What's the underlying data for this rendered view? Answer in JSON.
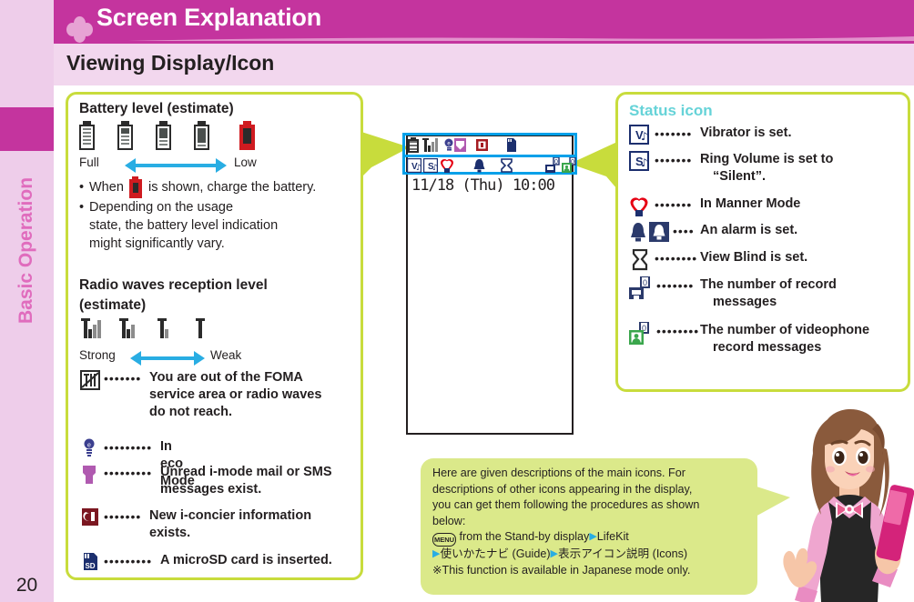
{
  "sidebar": {
    "chapter_label": "Basic Operation",
    "page_number": "20"
  },
  "header": {
    "title": "Screen Explanation",
    "flower_icon": "clover-flower-icon",
    "bg_color": "#c4349e"
  },
  "subheader": {
    "title": "Viewing Display/Icon",
    "bg_color": "#f2d7ee"
  },
  "left_panel": {
    "battery_section": {
      "title": "Battery level (estimate)",
      "scale_start_label": "Full",
      "scale_end_label": "Low",
      "battery_levels": [
        100,
        75,
        50,
        25,
        5
      ],
      "bullets": [
        "When   is shown, charge the battery.",
        "Depending on the usage state, the battery level indication might significantly vary."
      ],
      "bullet1_prefix": "When",
      "bullet1_suffix": "is shown, charge the battery.",
      "bullet2_line1": "Depending on the usage",
      "bullet2_line2": "state, the battery level indication",
      "bullet2_line3": "might significantly vary."
    },
    "radio_section": {
      "title_line1": "Radio waves reception level",
      "title_line2": "(estimate)",
      "scale_start_label": "Strong",
      "scale_end_label": "Weak",
      "antenna_levels": [
        3,
        2,
        1,
        0
      ]
    },
    "icon_items": [
      {
        "icon": "out-of-service-area-icon",
        "dots": "•••••••",
        "lines": [
          "You are out of the FOMA",
          "service area or radio waves",
          "do not reach."
        ]
      },
      {
        "icon": "eco-mode-icon",
        "dots": "•••••••••",
        "lines": [
          "In eco Mode"
        ]
      },
      {
        "icon": "unread-mail-icon",
        "dots": "•••••••••",
        "lines": [
          "Unread i-mode mail or SMS",
          "messages exist."
        ]
      },
      {
        "icon": "i-concier-icon",
        "dots": "•••••••",
        "lines": [
          "New i-concier information",
          "exists."
        ]
      },
      {
        "icon": "microsd-card-icon",
        "dots": "•••••••••",
        "lines": [
          "A microSD card is inserted."
        ]
      }
    ]
  },
  "phone_display": {
    "datetime": "11/18 (Thu) 10:00",
    "highlight_color": "#00a0e9",
    "status_row_1": [
      "battery-icon",
      "antenna-icon",
      "eco-mode-icon",
      "unread-mail-icon",
      "i-concier-icon",
      "microsd-card-icon"
    ],
    "status_row_2": [
      "vibrator-icon",
      "silent-ring-icon",
      "manner-mode-icon",
      "alarm-bell-icon",
      "view-blind-icon",
      "record-message-icon",
      "videophone-record-icon"
    ]
  },
  "right_panel": {
    "heading": "Status icon",
    "heading_color": "#66d3d8",
    "items": [
      {
        "icon": "vibrator-icon",
        "dots": "•••••••",
        "lines": [
          "Vibrator is set."
        ]
      },
      {
        "icon": "silent-ring-volume-icon",
        "dots": "•••••••",
        "lines": [
          "Ring Volume is set to",
          "“Silent”."
        ]
      },
      {
        "icon": "manner-mode-heart-icon",
        "dots": "•••••••",
        "lines": [
          "In Manner Mode"
        ]
      },
      {
        "icon": "alarm-bell-icon",
        "dots": "••••",
        "lines": [
          "An alarm is set."
        ]
      },
      {
        "icon": "view-blind-icon",
        "dots": "••••••••",
        "lines": [
          "View Blind is set."
        ]
      },
      {
        "icon": "record-message-icon",
        "dots": "•••••••",
        "lines": [
          "The number of record",
          "messages"
        ]
      },
      {
        "icon": "videophone-record-message-icon",
        "dots": "••••••••",
        "lines": [
          "The number of videophone",
          "record messages"
        ]
      }
    ]
  },
  "callout": {
    "line1": "Here are given descriptions of the main icons. For",
    "line2": "descriptions of other icons appearing in the display,",
    "line3": "you can get them following the procedures as shown",
    "line4": "below:",
    "menu_key_label": "MENU",
    "line5_after_key": " from the Stand-by display",
    "line5_item": "LifeKit",
    "line6_item1": "使いかたナビ (Guide)",
    "line6_item2": "表示アイコン説明 (Icons)",
    "line7": "※This function is available in Japanese mode only.",
    "bg_color": "#dbe98a"
  },
  "character": {
    "name": "guide-character-illustration",
    "holds": "pink-mobile-phone"
  }
}
